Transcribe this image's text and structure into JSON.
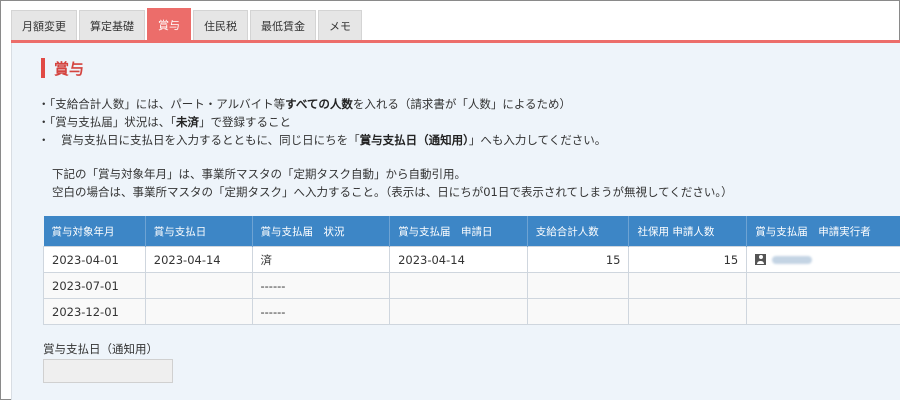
{
  "tabs": [
    {
      "label": "月額変更",
      "active": false
    },
    {
      "label": "算定基礎",
      "active": false
    },
    {
      "label": "賞与",
      "active": true
    },
    {
      "label": "住民税",
      "active": false
    },
    {
      "label": "最低賃金",
      "active": false
    },
    {
      "label": "メモ",
      "active": false
    }
  ],
  "section_title": "賞与",
  "notes": [
    {
      "prefix": "・「支給合計人数」には、パート・アルバイト等",
      "bold": "すべての人数",
      "suffix": "を入れる（請求書が「人数」によるため）"
    },
    {
      "prefix": "・「賞与支払届」状況は、「",
      "bold": "未済",
      "suffix": "」で登録すること"
    },
    {
      "prefix": "・　賞与支払日に支払日を入力するとともに、同じ日にちを「",
      "bold": "賞与支払日（通知用）",
      "suffix": "」へも入力してください。"
    }
  ],
  "notes2": [
    {
      "prefix": "下記の「",
      "bold": "賞与対象年月",
      "suffix": "」は、事業所マスタの「定期タスク自動」から自動引用。"
    },
    {
      "prefix": "空白の場合は、事業所マスタの「定期タスク」へ入力すること。（表示は、日にちが01日で表示されてしまうが無視してください。）",
      "bold": "",
      "suffix": ""
    }
  ],
  "table": {
    "headers": [
      "賞与対象年月",
      "賞与支払日",
      "賞与支払届　状況",
      "賞与支払届　申請日",
      "支給合計人数",
      "社保用 申請人数",
      "賞与支払届　申請実行者"
    ],
    "rows": [
      [
        "2023-04-01",
        "2023-04-14",
        "済",
        "2023-04-14",
        "15",
        "15",
        ""
      ],
      [
        "2023-07-01",
        "",
        "------",
        "",
        "",
        "",
        ""
      ],
      [
        "2023-12-01",
        "",
        "------",
        "",
        "",
        "",
        ""
      ]
    ]
  },
  "field": {
    "label": "賞与支払日（通知用）",
    "value": ""
  },
  "colors": {
    "accent": "#ec6d6a",
    "heading": "#d4443f",
    "table_header": "#3d86c6",
    "panel_bg": "#eef4fa"
  }
}
